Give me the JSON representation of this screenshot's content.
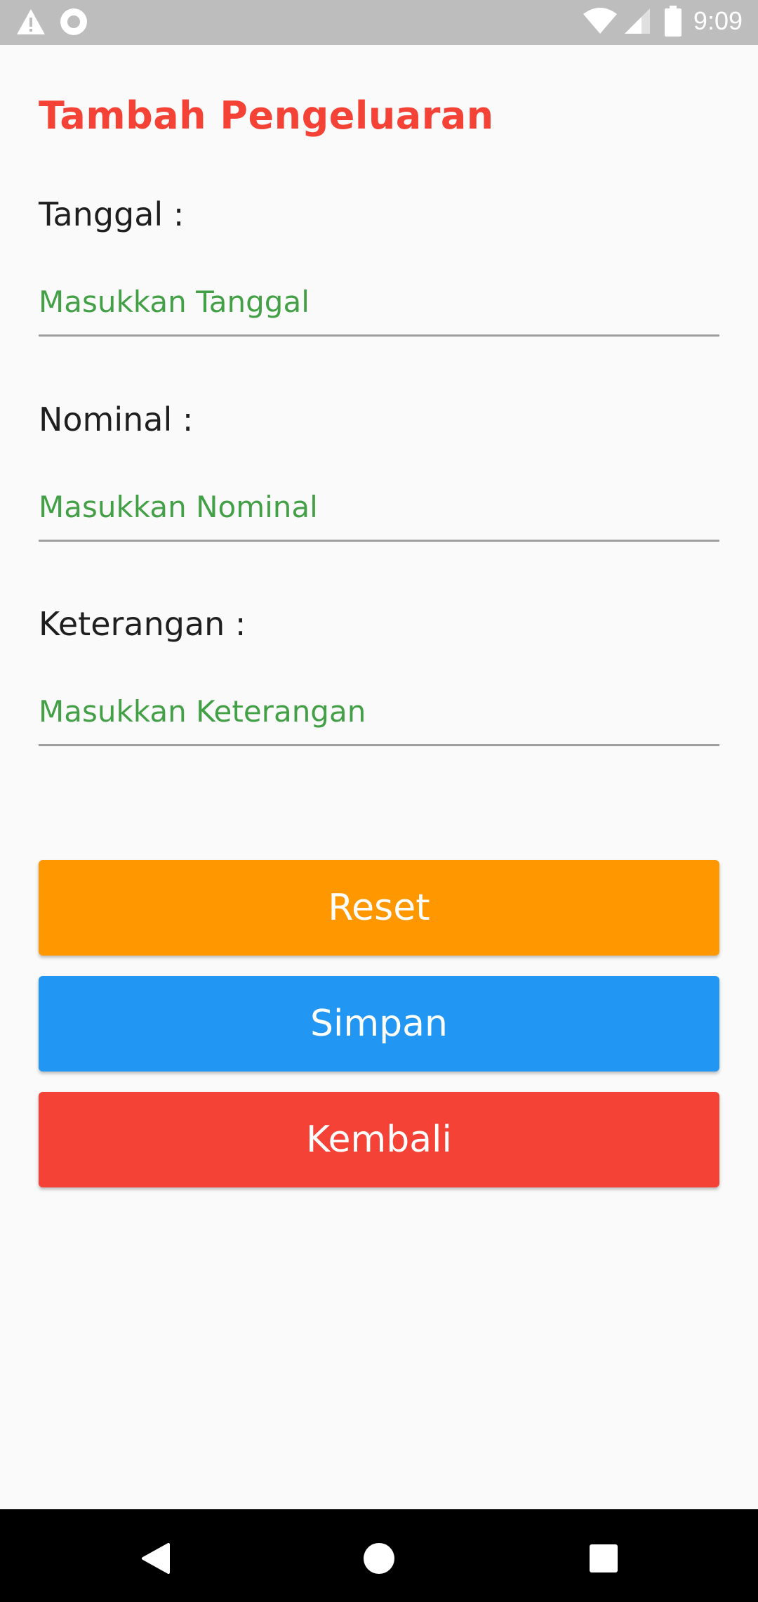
{
  "status_bar": {
    "time": "9:09",
    "icons": [
      "warning-icon",
      "circle-icon",
      "wifi-icon",
      "signal-icon",
      "battery-icon"
    ],
    "background": "#bdbdbd"
  },
  "form": {
    "title": "Tambah Pengeluaran",
    "fields": [
      {
        "label": "Tanggal :",
        "placeholder": "Masukkan Tanggal",
        "value": ""
      },
      {
        "label": "Nominal :",
        "placeholder": "Masukkan Nominal",
        "value": ""
      },
      {
        "label": "Keterangan :",
        "placeholder": "Masukkan Keterangan",
        "value": ""
      }
    ],
    "buttons": {
      "reset": "Reset",
      "simpan": "Simpan",
      "kembali": "Kembali"
    }
  },
  "nav_bar": {
    "icons": [
      "back-icon",
      "home-icon",
      "recents-icon"
    ]
  },
  "colors": {
    "title": "#f44336",
    "placeholder": "#43a047",
    "reset": "#ff9800",
    "simpan": "#2196f3",
    "kembali": "#f44336"
  }
}
